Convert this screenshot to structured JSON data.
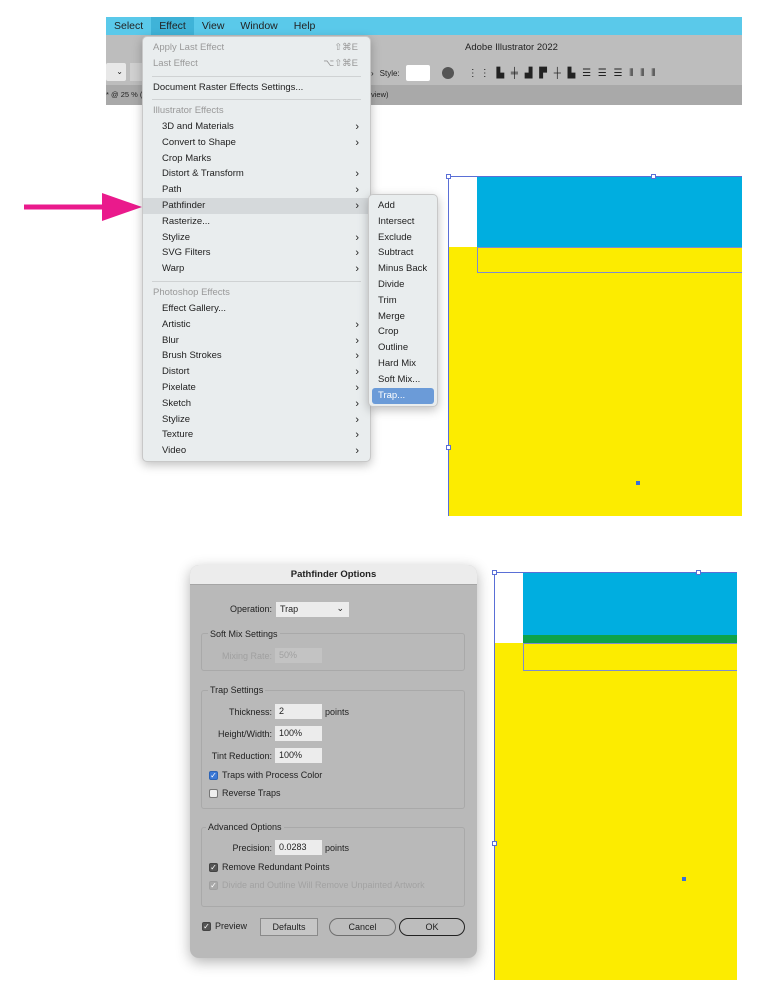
{
  "menubar": {
    "items": [
      "Select",
      "Effect",
      "View",
      "Window",
      "Help"
    ],
    "active": "Effect"
  },
  "app": {
    "title": "Adobe Illustrator 2022",
    "style_label": "Style:",
    "doc_tab": "* @ 25 % (",
    "doc_tab_suffix": "view)"
  },
  "effect_menu": {
    "apply_last": {
      "label": "Apply Last Effect",
      "shortcut": "⇧⌘E"
    },
    "last": {
      "label": "Last Effect",
      "shortcut": "⌥⇧⌘E"
    },
    "doc_raster": "Document Raster Effects Settings...",
    "illustrator_header": "Illustrator Effects",
    "illustrator_items": [
      "3D and Materials",
      "Convert to Shape",
      "Crop Marks",
      "Distort & Transform",
      "Path",
      "Pathfinder",
      "Rasterize...",
      "Stylize",
      "SVG Filters",
      "Warp"
    ],
    "photoshop_header": "Photoshop Effects",
    "photoshop_items": [
      "Effect Gallery...",
      "Artistic",
      "Blur",
      "Brush Strokes",
      "Distort",
      "Pixelate",
      "Sketch",
      "Stylize",
      "Texture",
      "Video"
    ],
    "highlighted": "Pathfinder"
  },
  "pathfinder_submenu": {
    "items": [
      "Add",
      "Intersect",
      "Exclude",
      "Subtract",
      "Minus Back",
      "Divide",
      "Trim",
      "Merge",
      "Crop",
      "Outline",
      "Hard Mix",
      "Soft Mix...",
      "Trap..."
    ],
    "selected": "Trap..."
  },
  "colors": {
    "arrow": "#ea1a8c",
    "menubar": "#5ac9ea",
    "artwork_blue": "#00aee0",
    "artwork_yellow": "#fcec00",
    "trap_green": "#0ea34a",
    "selection": "#5a6fd6"
  },
  "dialog": {
    "title": "Pathfinder Options",
    "operation_label": "Operation:",
    "operation_value": "Trap",
    "soft_mix": {
      "title": "Soft Mix Settings",
      "mixing_rate_label": "Mixing Rate:",
      "mixing_rate_value": "50%"
    },
    "trap": {
      "title": "Trap Settings",
      "thickness_label": "Thickness:",
      "thickness_value": "2",
      "thickness_unit": "points",
      "hw_label": "Height/Width:",
      "hw_value": "100%",
      "tint_label": "Tint Reduction:",
      "tint_value": "100%",
      "process_label": "Traps with Process Color",
      "process_checked": true,
      "reverse_label": "Reverse Traps",
      "reverse_checked": false
    },
    "advanced": {
      "title": "Advanced Options",
      "precision_label": "Precision:",
      "precision_value": "0.0283",
      "precision_unit": "points",
      "redundant_label": "Remove Redundant Points",
      "redundant_checked": true,
      "divide_label": "Divide and Outline Will Remove Unpainted Artwork",
      "divide_checked": true
    },
    "preview_label": "Preview",
    "preview_checked": true,
    "defaults": "Defaults",
    "cancel": "Cancel",
    "ok": "OK"
  }
}
